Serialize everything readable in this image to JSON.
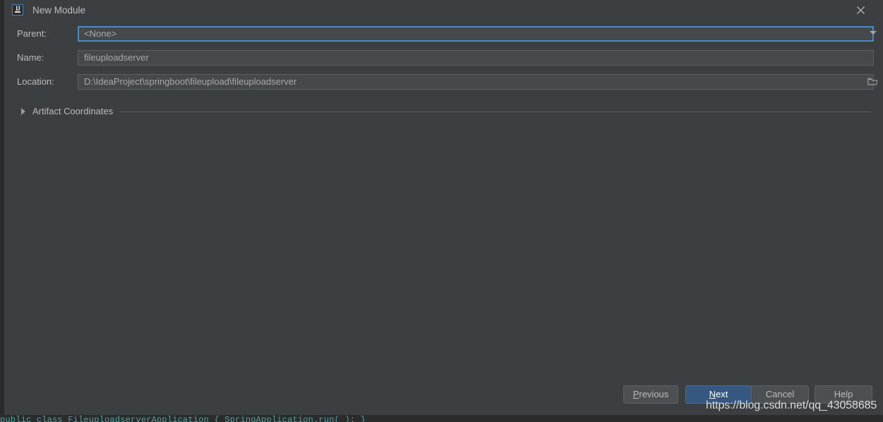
{
  "window": {
    "title": "New Module",
    "app_icon": "intellij-idea-icon",
    "icon_text": "IJ",
    "close_icon": "close-icon"
  },
  "form": {
    "rows": [
      {
        "label": "Parent:",
        "value": "<None>",
        "control": "combobox",
        "trailing_icon": "chevron-down-icon",
        "focused": true
      },
      {
        "label": "Name:",
        "value": "fileuploadserver",
        "control": "textfield",
        "trailing_icon": "",
        "focused": false
      },
      {
        "label": "Location:",
        "value": "D:\\IdeaProject\\springboot\\fileupload\\fileuploadserver",
        "control": "textfield-with-browse",
        "trailing_icon": "folder-icon",
        "focused": false
      }
    ]
  },
  "artifact_section": {
    "label": "Artifact Coordinates",
    "expanded": false,
    "toggle_icon": "triangle-right-icon"
  },
  "footer": {
    "buttons": [
      {
        "label": "Previous",
        "mnemonic": "P",
        "primary": false
      },
      {
        "label": "Next",
        "mnemonic": "N",
        "primary": true
      },
      {
        "label": "Cancel",
        "mnemonic": "",
        "primary": false
      },
      {
        "label": "Help",
        "mnemonic": "",
        "primary": false
      }
    ]
  },
  "watermark": {
    "text": "https://blog.csdn.net/qq_43058685"
  },
  "colors": {
    "dialog_background": "#3c3f41",
    "field_background": "#45494a",
    "field_border": "#5e6060",
    "focus_border": "#4b88c4",
    "primary_button": "#365880",
    "text": "#bbbbbb",
    "ide_background": "#2b2b2b"
  },
  "background_code": {
    "line": "public class FileuploadserverApplication { SpringApplication.run( ); }"
  }
}
